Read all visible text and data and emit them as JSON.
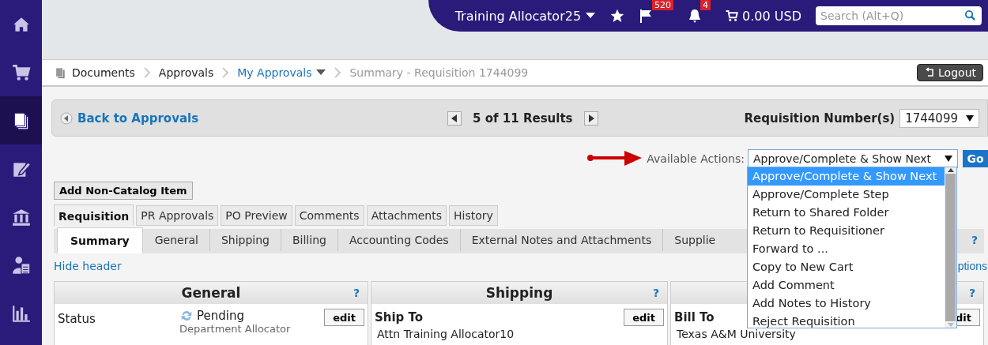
{
  "sidebar": {
    "items": [
      {
        "kind": "home",
        "selected": false
      },
      {
        "kind": "cart",
        "selected": false
      },
      {
        "kind": "documents",
        "selected": true
      },
      {
        "kind": "edit",
        "selected": false
      },
      {
        "kind": "bank",
        "selected": false
      },
      {
        "kind": "person",
        "selected": false
      },
      {
        "kind": "chart",
        "selected": false
      }
    ]
  },
  "header": {
    "user": "Training Allocator25",
    "flag_count": "520",
    "bell_count": "4",
    "cart_total": "0.00 USD",
    "search": {
      "placeholder": "Search (Alt+Q)"
    }
  },
  "breadcrumb": [
    {
      "label": "Documents",
      "kind": "root"
    },
    {
      "label": "Approvals",
      "kind": "plain"
    },
    {
      "label": "My Approvals",
      "kind": "link"
    },
    {
      "label": "Summary - Requisition 1744099",
      "kind": "current"
    }
  ],
  "logout": "Logout",
  "results_bar": {
    "back": "Back to Approvals",
    "results": "5 of 11 Results",
    "number_label": "Requisition Number(s)",
    "number_value": "1744099"
  },
  "actions": {
    "label": "Available Actions:",
    "value": "Approve/Complete & Show Next",
    "go": "Go",
    "options": [
      {
        "label": "Approve/Complete & Show Next",
        "selected": true
      },
      {
        "label": "Approve/Complete Step",
        "selected": false
      },
      {
        "label": "Return to Shared Folder",
        "selected": false
      },
      {
        "label": "Return to Requisitioner",
        "selected": false
      },
      {
        "label": "Forward to ...",
        "selected": false
      },
      {
        "label": "Copy to New Cart",
        "selected": false
      },
      {
        "label": "Add Comment",
        "selected": false
      },
      {
        "label": "Add Notes to History",
        "selected": false
      },
      {
        "label": "Reject Requisition",
        "selected": false
      }
    ]
  },
  "add_button": "Add Non-Catalog Item",
  "tabs": [
    {
      "label": "Requisition",
      "selected": true
    },
    {
      "label": "PR Approvals",
      "selected": false
    },
    {
      "label": "PO Preview",
      "selected": false
    },
    {
      "label": "Comments",
      "selected": false
    },
    {
      "label": "Attachments",
      "selected": false
    },
    {
      "label": "History",
      "selected": false
    }
  ],
  "subtabs": [
    {
      "label": "Summary",
      "selected": true
    },
    {
      "label": "General",
      "selected": false
    },
    {
      "label": "Shipping",
      "selected": false
    },
    {
      "label": "Billing",
      "selected": false
    },
    {
      "label": "Accounting Codes",
      "selected": false
    },
    {
      "label": "External Notes and Attachments",
      "selected": false
    },
    {
      "label": "Supplie",
      "selected": false
    }
  ],
  "subtabs_help": "?",
  "hide_header": "Hide header",
  "options_link": "ptions",
  "panels": [
    {
      "kind": "status",
      "title": "General",
      "help": "?",
      "label": "Status",
      "value": "Pending",
      "note": "Department Allocator",
      "edit": "edit"
    },
    {
      "kind": "address",
      "title": "Shipping",
      "help": "?",
      "heading": "Ship To",
      "value": "Attn Training Allocator10",
      "edit": "edit"
    },
    {
      "kind": "address",
      "help": "?",
      "heading": "Bill To",
      "value": "Texas A&M University",
      "edit": "dit"
    }
  ]
}
